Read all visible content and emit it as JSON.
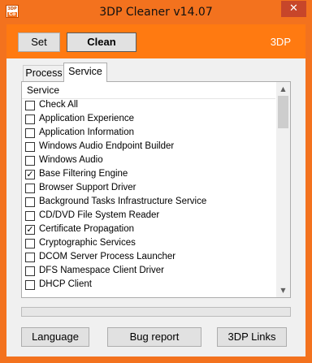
{
  "window": {
    "title": "3DP Cleaner v14.07",
    "close_glyph": "✕",
    "icon_top": "3DP",
    "icon_bottom": "Co"
  },
  "toolbar": {
    "set_label": "Set",
    "clean_label": "Clean",
    "brand": "3DP"
  },
  "tabs": [
    {
      "label": "Process",
      "selected": false
    },
    {
      "label": "Service",
      "selected": true
    }
  ],
  "list": {
    "header": "Service",
    "items": [
      {
        "label": "Check All",
        "checked": false
      },
      {
        "label": "Application Experience",
        "checked": false
      },
      {
        "label": "Application Information",
        "checked": false
      },
      {
        "label": "Windows Audio Endpoint Builder",
        "checked": false
      },
      {
        "label": "Windows Audio",
        "checked": false
      },
      {
        "label": "Base Filtering Engine",
        "checked": true
      },
      {
        "label": "Browser Support Driver",
        "checked": false
      },
      {
        "label": "Background Tasks Infrastructure Service",
        "checked": false
      },
      {
        "label": "CD/DVD File System Reader",
        "checked": false
      },
      {
        "label": "Certificate Propagation",
        "checked": true
      },
      {
        "label": "Cryptographic Services",
        "checked": false
      },
      {
        "label": "DCOM Server Process Launcher",
        "checked": false
      },
      {
        "label": "DFS Namespace Client Driver",
        "checked": false
      },
      {
        "label": "DHCP Client",
        "checked": false
      }
    ]
  },
  "progress": {
    "value": 0
  },
  "bottom": {
    "language_label": "Language",
    "bug_label": "Bug report",
    "links_label": "3DP Links"
  },
  "colors": {
    "accent": "#f3721e",
    "toolbar": "#ff7a11",
    "close": "#c7462a"
  }
}
